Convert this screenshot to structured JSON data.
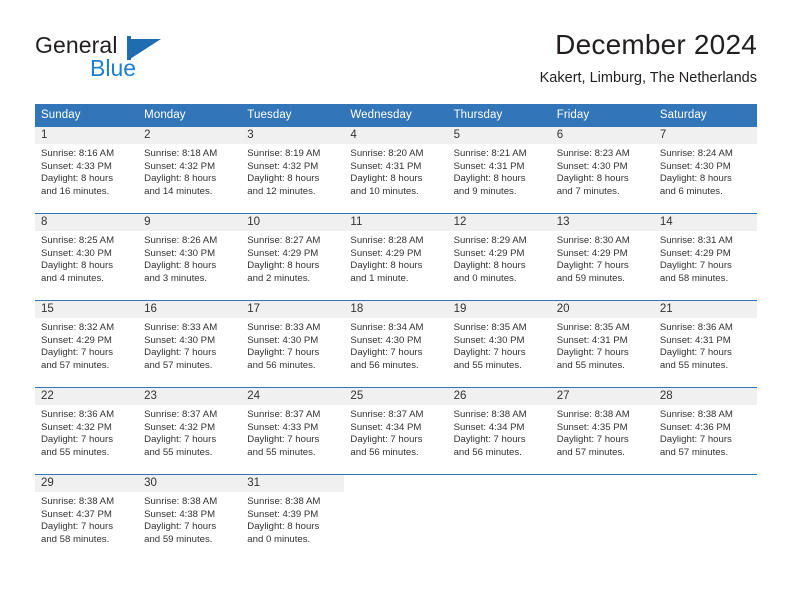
{
  "brand": {
    "name_top": "General",
    "name_bottom": "Blue",
    "triangle_color": "#1f6cb0",
    "blue_text_color": "#1f7fd0"
  },
  "header": {
    "title": "December 2024",
    "subtitle": "Kakert, Limburg, The Netherlands"
  },
  "theme": {
    "header_blue": "#3275b8",
    "daynum_bg": "#f0f0f0",
    "text": "#333333"
  },
  "weekdays": [
    "Sunday",
    "Monday",
    "Tuesday",
    "Wednesday",
    "Thursday",
    "Friday",
    "Saturday"
  ],
  "labels": {
    "sunrise": "Sunrise:",
    "sunset": "Sunset:",
    "daylight": "Daylight:"
  },
  "weeks": [
    [
      {
        "day": "1",
        "sunrise": "Sunrise: 8:16 AM",
        "sunset": "Sunset: 4:33 PM",
        "daylight1": "Daylight: 8 hours",
        "daylight2": "and 16 minutes."
      },
      {
        "day": "2",
        "sunrise": "Sunrise: 8:18 AM",
        "sunset": "Sunset: 4:32 PM",
        "daylight1": "Daylight: 8 hours",
        "daylight2": "and 14 minutes."
      },
      {
        "day": "3",
        "sunrise": "Sunrise: 8:19 AM",
        "sunset": "Sunset: 4:32 PM",
        "daylight1": "Daylight: 8 hours",
        "daylight2": "and 12 minutes."
      },
      {
        "day": "4",
        "sunrise": "Sunrise: 8:20 AM",
        "sunset": "Sunset: 4:31 PM",
        "daylight1": "Daylight: 8 hours",
        "daylight2": "and 10 minutes."
      },
      {
        "day": "5",
        "sunrise": "Sunrise: 8:21 AM",
        "sunset": "Sunset: 4:31 PM",
        "daylight1": "Daylight: 8 hours",
        "daylight2": "and 9 minutes."
      },
      {
        "day": "6",
        "sunrise": "Sunrise: 8:23 AM",
        "sunset": "Sunset: 4:30 PM",
        "daylight1": "Daylight: 8 hours",
        "daylight2": "and 7 minutes."
      },
      {
        "day": "7",
        "sunrise": "Sunrise: 8:24 AM",
        "sunset": "Sunset: 4:30 PM",
        "daylight1": "Daylight: 8 hours",
        "daylight2": "and 6 minutes."
      }
    ],
    [
      {
        "day": "8",
        "sunrise": "Sunrise: 8:25 AM",
        "sunset": "Sunset: 4:30 PM",
        "daylight1": "Daylight: 8 hours",
        "daylight2": "and 4 minutes."
      },
      {
        "day": "9",
        "sunrise": "Sunrise: 8:26 AM",
        "sunset": "Sunset: 4:30 PM",
        "daylight1": "Daylight: 8 hours",
        "daylight2": "and 3 minutes."
      },
      {
        "day": "10",
        "sunrise": "Sunrise: 8:27 AM",
        "sunset": "Sunset: 4:29 PM",
        "daylight1": "Daylight: 8 hours",
        "daylight2": "and 2 minutes."
      },
      {
        "day": "11",
        "sunrise": "Sunrise: 8:28 AM",
        "sunset": "Sunset: 4:29 PM",
        "daylight1": "Daylight: 8 hours",
        "daylight2": "and 1 minute."
      },
      {
        "day": "12",
        "sunrise": "Sunrise: 8:29 AM",
        "sunset": "Sunset: 4:29 PM",
        "daylight1": "Daylight: 8 hours",
        "daylight2": "and 0 minutes."
      },
      {
        "day": "13",
        "sunrise": "Sunrise: 8:30 AM",
        "sunset": "Sunset: 4:29 PM",
        "daylight1": "Daylight: 7 hours",
        "daylight2": "and 59 minutes."
      },
      {
        "day": "14",
        "sunrise": "Sunrise: 8:31 AM",
        "sunset": "Sunset: 4:29 PM",
        "daylight1": "Daylight: 7 hours",
        "daylight2": "and 58 minutes."
      }
    ],
    [
      {
        "day": "15",
        "sunrise": "Sunrise: 8:32 AM",
        "sunset": "Sunset: 4:29 PM",
        "daylight1": "Daylight: 7 hours",
        "daylight2": "and 57 minutes."
      },
      {
        "day": "16",
        "sunrise": "Sunrise: 8:33 AM",
        "sunset": "Sunset: 4:30 PM",
        "daylight1": "Daylight: 7 hours",
        "daylight2": "and 57 minutes."
      },
      {
        "day": "17",
        "sunrise": "Sunrise: 8:33 AM",
        "sunset": "Sunset: 4:30 PM",
        "daylight1": "Daylight: 7 hours",
        "daylight2": "and 56 minutes."
      },
      {
        "day": "18",
        "sunrise": "Sunrise: 8:34 AM",
        "sunset": "Sunset: 4:30 PM",
        "daylight1": "Daylight: 7 hours",
        "daylight2": "and 56 minutes."
      },
      {
        "day": "19",
        "sunrise": "Sunrise: 8:35 AM",
        "sunset": "Sunset: 4:30 PM",
        "daylight1": "Daylight: 7 hours",
        "daylight2": "and 55 minutes."
      },
      {
        "day": "20",
        "sunrise": "Sunrise: 8:35 AM",
        "sunset": "Sunset: 4:31 PM",
        "daylight1": "Daylight: 7 hours",
        "daylight2": "and 55 minutes."
      },
      {
        "day": "21",
        "sunrise": "Sunrise: 8:36 AM",
        "sunset": "Sunset: 4:31 PM",
        "daylight1": "Daylight: 7 hours",
        "daylight2": "and 55 minutes."
      }
    ],
    [
      {
        "day": "22",
        "sunrise": "Sunrise: 8:36 AM",
        "sunset": "Sunset: 4:32 PM",
        "daylight1": "Daylight: 7 hours",
        "daylight2": "and 55 minutes."
      },
      {
        "day": "23",
        "sunrise": "Sunrise: 8:37 AM",
        "sunset": "Sunset: 4:32 PM",
        "daylight1": "Daylight: 7 hours",
        "daylight2": "and 55 minutes."
      },
      {
        "day": "24",
        "sunrise": "Sunrise: 8:37 AM",
        "sunset": "Sunset: 4:33 PM",
        "daylight1": "Daylight: 7 hours",
        "daylight2": "and 55 minutes."
      },
      {
        "day": "25",
        "sunrise": "Sunrise: 8:37 AM",
        "sunset": "Sunset: 4:34 PM",
        "daylight1": "Daylight: 7 hours",
        "daylight2": "and 56 minutes."
      },
      {
        "day": "26",
        "sunrise": "Sunrise: 8:38 AM",
        "sunset": "Sunset: 4:34 PM",
        "daylight1": "Daylight: 7 hours",
        "daylight2": "and 56 minutes."
      },
      {
        "day": "27",
        "sunrise": "Sunrise: 8:38 AM",
        "sunset": "Sunset: 4:35 PM",
        "daylight1": "Daylight: 7 hours",
        "daylight2": "and 57 minutes."
      },
      {
        "day": "28",
        "sunrise": "Sunrise: 8:38 AM",
        "sunset": "Sunset: 4:36 PM",
        "daylight1": "Daylight: 7 hours",
        "daylight2": "and 57 minutes."
      }
    ],
    [
      {
        "day": "29",
        "sunrise": "Sunrise: 8:38 AM",
        "sunset": "Sunset: 4:37 PM",
        "daylight1": "Daylight: 7 hours",
        "daylight2": "and 58 minutes."
      },
      {
        "day": "30",
        "sunrise": "Sunrise: 8:38 AM",
        "sunset": "Sunset: 4:38 PM",
        "daylight1": "Daylight: 7 hours",
        "daylight2": "and 59 minutes."
      },
      {
        "day": "31",
        "sunrise": "Sunrise: 8:38 AM",
        "sunset": "Sunset: 4:39 PM",
        "daylight1": "Daylight: 8 hours",
        "daylight2": "and 0 minutes."
      },
      {
        "day": "",
        "sunrise": "",
        "sunset": "",
        "daylight1": "",
        "daylight2": ""
      },
      {
        "day": "",
        "sunrise": "",
        "sunset": "",
        "daylight1": "",
        "daylight2": ""
      },
      {
        "day": "",
        "sunrise": "",
        "sunset": "",
        "daylight1": "",
        "daylight2": ""
      },
      {
        "day": "",
        "sunrise": "",
        "sunset": "",
        "daylight1": "",
        "daylight2": ""
      }
    ]
  ]
}
